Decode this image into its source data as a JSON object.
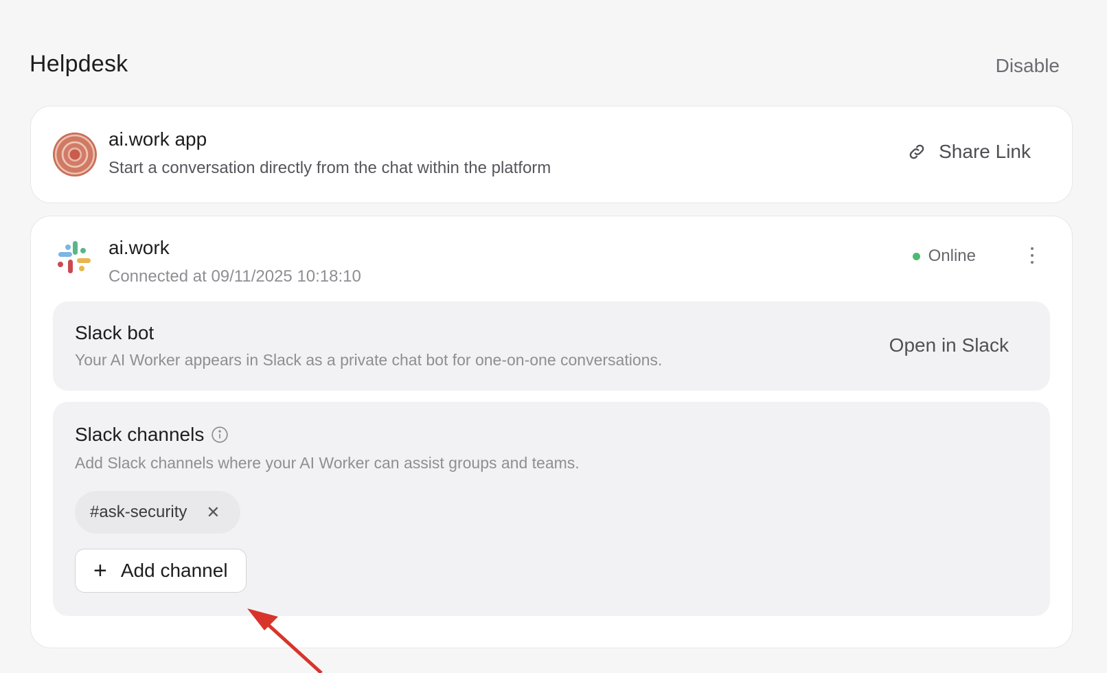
{
  "header": {
    "title": "Helpdesk",
    "disable_label": "Disable"
  },
  "app_card": {
    "name": "ai.work app",
    "description": "Start a conversation directly from the chat within the platform",
    "share_label": "Share Link",
    "icon": "link-icon"
  },
  "slack_card": {
    "name": "ai.work",
    "connected": "Connected at 09/11/2025 10:18:10",
    "status": "Online",
    "status_color": "#4dbb6f",
    "bot": {
      "title": "Slack bot",
      "description": "Your AI Worker appears in Slack as a private chat bot for one-on-one conversations.",
      "open_label": "Open in Slack"
    },
    "channels": {
      "title": "Slack channels",
      "description": "Add Slack channels where your AI Worker can assist groups and teams.",
      "items": [
        "#ask-security"
      ],
      "add_label": "Add channel"
    }
  },
  "annotation": {
    "arrow_color": "#d9342b"
  }
}
